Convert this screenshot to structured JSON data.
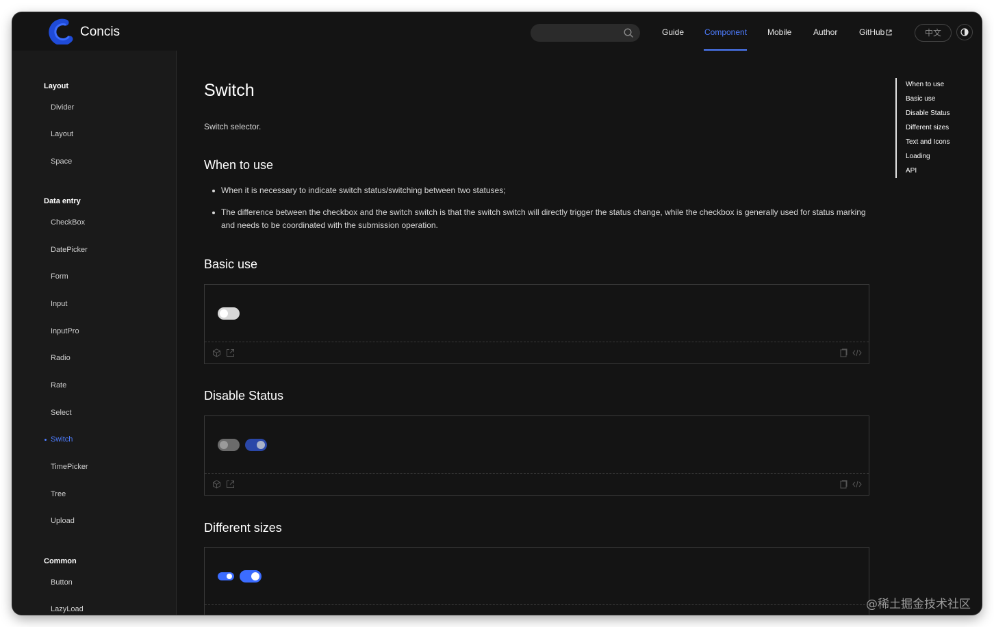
{
  "app": {
    "brand": "Concis"
  },
  "header": {
    "search_placeholder": "",
    "nav": [
      "Guide",
      "Component",
      "Mobile",
      "Author",
      "GitHub"
    ],
    "lang": "中文",
    "accent": "#4d7cfe"
  },
  "sidebar": {
    "groups": [
      {
        "title": "Layout",
        "items": [
          "Divider",
          "Layout",
          "Space"
        ]
      },
      {
        "title": "Data entry",
        "items": [
          "CheckBox",
          "DatePicker",
          "Form",
          "Input",
          "InputPro",
          "Radio",
          "Rate",
          "Select",
          "Switch",
          "TimePicker",
          "Tree",
          "Upload"
        ]
      },
      {
        "title": "Common",
        "items": [
          "Button",
          "LazyLoad"
        ]
      }
    ],
    "active": "Switch"
  },
  "main": {
    "title": "Switch",
    "description": "Switch selector.",
    "sections": {
      "when_to_use": {
        "heading": "When to use",
        "bullets": [
          "When it is necessary to indicate switch status/switching between two statuses;",
          "The difference between the checkbox and the switch switch is that the switch switch will directly trigger the status change, while the checkbox is generally used for status marking and needs to be coordinated with the submission operation."
        ]
      },
      "basic_use": {
        "heading": "Basic use",
        "switches": [
          {
            "checked": false,
            "disabled": false
          }
        ]
      },
      "disable_status": {
        "heading": "Disable Status",
        "switches": [
          {
            "checked": false,
            "disabled": true
          },
          {
            "checked": true,
            "disabled": true
          }
        ]
      },
      "different_sizes": {
        "heading": "Different sizes",
        "switches": [
          {
            "checked": true,
            "size": "small"
          },
          {
            "checked": true,
            "size": "default"
          }
        ]
      }
    }
  },
  "toc": [
    "When to use",
    "Basic use",
    "Disable Status",
    "Different sizes",
    "Text and Icons",
    "Loading",
    "API"
  ],
  "watermark": "@稀土掘金技术社区"
}
